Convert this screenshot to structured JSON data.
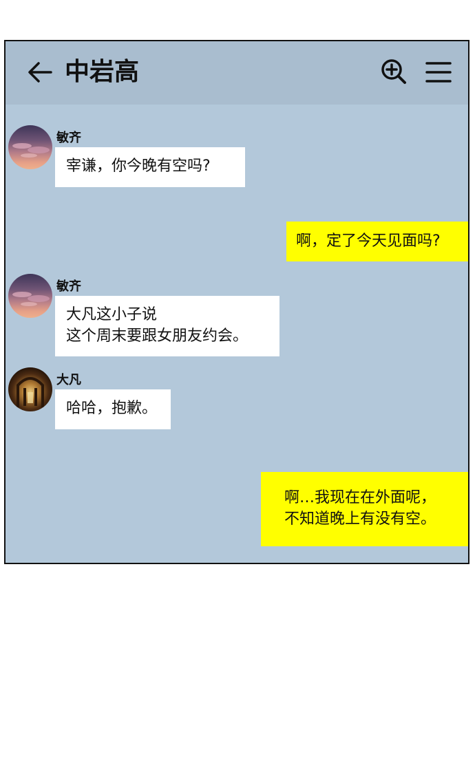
{
  "header": {
    "title": "中岩高",
    "back_icon": "arrow-left-icon",
    "search_icon": "zoom-in-icon",
    "menu_icon": "hamburger-menu-icon"
  },
  "colors": {
    "chat_background": "#b3c8da",
    "header_background": "#a9bdcf",
    "incoming_bubble": "#ffffff",
    "outgoing_bubble": "#ffff00"
  },
  "messages": [
    {
      "type": "incoming",
      "sender": "敏齐",
      "text": "宰谦，你今晚有空吗?"
    },
    {
      "type": "outgoing",
      "text": "啊，定了今天见面吗?"
    },
    {
      "type": "incoming",
      "sender": "敏齐",
      "text": "大凡这小子说\n这个周末要跟女朋友约会。"
    },
    {
      "type": "incoming",
      "sender": "大凡",
      "text": "哈哈，抱歉。"
    },
    {
      "type": "outgoing",
      "text": "啊…我现在在外面呢，\n不知道晚上有没有空。"
    }
  ]
}
